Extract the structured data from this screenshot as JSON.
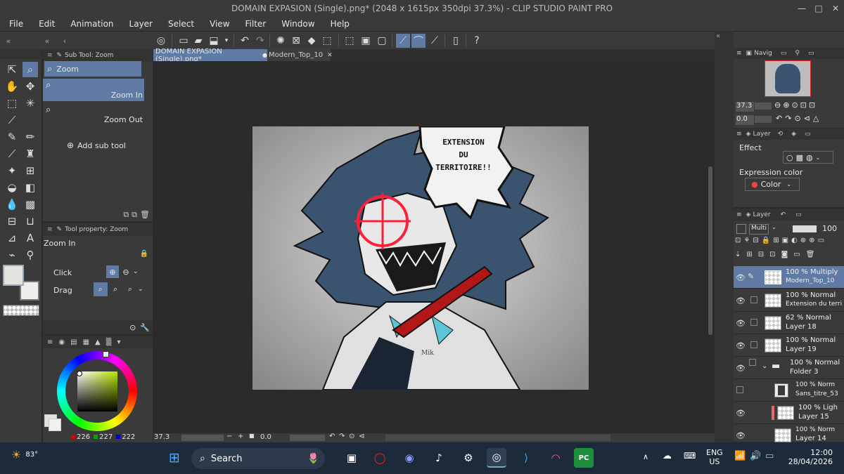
{
  "window": {
    "title": "DOMAIN EXPASION (Single).png* (2048 x 1615px 350dpi 37.3%) - CLIP STUDIO PAINT PRO",
    "min": "—",
    "max": "□",
    "close": "✕"
  },
  "menu": [
    "File",
    "Edit",
    "Animation",
    "Layer",
    "Select",
    "View",
    "Filter",
    "Window",
    "Help"
  ],
  "tabs": [
    {
      "label": "DOMAIN EXPASION (Single).png*",
      "active": true
    },
    {
      "label": "Modern_Top_10",
      "active": false
    }
  ],
  "subtool": {
    "panel_title": "Sub Tool: Zoom",
    "group": "Zoom",
    "items": [
      "Zoom In",
      "Zoom Out"
    ],
    "add": "Add sub tool",
    "tool_short": "Too"
  },
  "toolprop": {
    "panel_title": "Tool property: Zoom",
    "name": "Zoom In",
    "click_label": "Click",
    "drag_label": "Drag"
  },
  "color": {
    "r": "226",
    "g": "227",
    "b": "222"
  },
  "canvas": {
    "speech_text": "EXTENSION DU TERRITOIRE!!",
    "speech_lines": [
      "EXTENSION",
      "DU",
      "TERRITOIRE!!"
    ],
    "signature": "Mik"
  },
  "status": {
    "zoom": "37.3",
    "angle": "0.0"
  },
  "navigator": {
    "title": "Navig",
    "zoom": "37.3",
    "angle": "0.0"
  },
  "layerprop": {
    "title": "Layer",
    "effect_label": "Effect",
    "expression_label": "Expression color",
    "expression_value": "Color"
  },
  "layers": {
    "title": "Layer",
    "blend": "Multi",
    "opacity": "100",
    "items": [
      {
        "mode": "100 % Multiply",
        "name": "Modern_Top_10",
        "selected": true
      },
      {
        "mode": "100 % Normal",
        "name": "Extension du terri",
        "selected": false
      },
      {
        "mode": "62 % Normal",
        "name": "Layer 18",
        "selected": false
      },
      {
        "mode": "100 % Normal",
        "name": "Layer 19",
        "selected": false
      },
      {
        "mode": "100 % Normal",
        "name": "Folder 3",
        "selected": false
      },
      {
        "mode": "100 % Norm",
        "name": "Sans_titre_53",
        "selected": false
      },
      {
        "mode": "100 % Ligh",
        "name": "Layer 15",
        "selected": false
      },
      {
        "mode": "100 % Norm",
        "name": "Layer 14",
        "selected": false
      }
    ]
  },
  "taskbar": {
    "weather": "83°",
    "search": "Search",
    "lang1": "ENG",
    "lang2": "US",
    "time": "12:00",
    "date": "28/04/2026"
  }
}
